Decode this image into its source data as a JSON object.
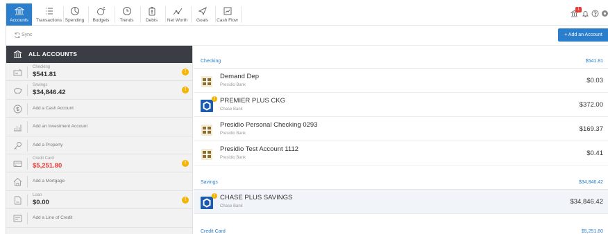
{
  "nav": {
    "items": [
      {
        "label": "Accounts",
        "icon": "bank-icon"
      },
      {
        "label": "Transactions",
        "icon": "list-icon"
      },
      {
        "label": "Spending",
        "icon": "pie-icon"
      },
      {
        "label": "Budgets",
        "icon": "budget-icon"
      },
      {
        "label": "Trends",
        "icon": "clock-icon"
      },
      {
        "label": "Debts",
        "icon": "debt-icon"
      },
      {
        "label": "Net Worth",
        "icon": "line-icon"
      },
      {
        "label": "Goals",
        "icon": "goal-icon"
      },
      {
        "label": "Cash Flow",
        "icon": "cashflow-icon"
      }
    ],
    "alert_count": "1"
  },
  "subbar": {
    "sync_label": "Sync",
    "add_account_label": "+ Add an Account"
  },
  "sidebar": {
    "title": "ALL ACCOUNTS",
    "rows": [
      {
        "caption": "Checking",
        "amount": "$541.81",
        "warn": "!"
      },
      {
        "caption": "Savings",
        "amount": "$34,846.42",
        "warn": "!"
      },
      {
        "add": "Add a Cash Account"
      },
      {
        "add": "Add an Investment Account"
      },
      {
        "add": "Add a Property"
      },
      {
        "caption": "Credit Card",
        "amount": "$5,251.80",
        "warn": "!"
      },
      {
        "add": "Add a Mortgage"
      },
      {
        "caption": "Loan",
        "amount": "$0.00",
        "warn": "!"
      },
      {
        "add": "Add a Line of Credit"
      }
    ]
  },
  "main": {
    "checking": {
      "label": "Checking",
      "total": "$541.81",
      "accounts": [
        {
          "name": "Demand Dep",
          "bank": "Presidio Bank",
          "balance": "$0.03"
        },
        {
          "name": "PREMIER PLUS CKG",
          "bank": "Chase Bank",
          "balance": "$372.00"
        },
        {
          "name": "Presidio Personal Checking 0293",
          "bank": "Presidio Bank",
          "balance": "$169.37"
        },
        {
          "name": "Presidio Test Account 1112",
          "bank": "Presidio Bank",
          "balance": "$0.41"
        }
      ]
    },
    "savings": {
      "label": "Savings",
      "total": "$34,846.42",
      "accounts": [
        {
          "name": "CHASE PLUS SAVINGS",
          "bank": "Chase Bank",
          "balance": "$34,846.42"
        }
      ]
    },
    "credit": {
      "label": "Credit Card",
      "total": "$5,251.80"
    }
  },
  "colors": {
    "accent": "#2a7ecb",
    "sidebar_header": "#3b3d44",
    "warning": "#f5b400",
    "negative": "#e53935",
    "chase": "#1a5bb1",
    "presidio": "#8a6d2f"
  }
}
